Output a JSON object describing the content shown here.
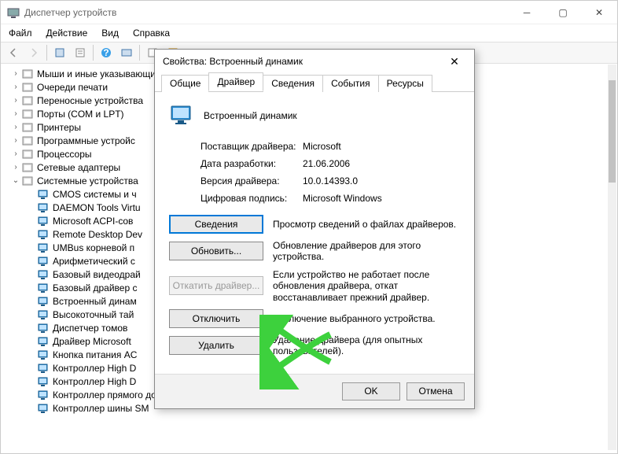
{
  "window": {
    "title": "Диспетчер устройств",
    "menu": {
      "file": "Файл",
      "action": "Действие",
      "view": "Вид",
      "help": "Справка"
    }
  },
  "tree": {
    "top": [
      {
        "label": "Мыши и иные указывающие",
        "icon": "mouse"
      },
      {
        "label": "Очереди печати",
        "icon": "printer"
      },
      {
        "label": "Переносные устройства",
        "icon": "portable"
      },
      {
        "label": "Порты (COM и LPT)",
        "icon": "port"
      },
      {
        "label": "Принтеры",
        "icon": "printer"
      },
      {
        "label": "Программные устройс",
        "icon": "soft"
      },
      {
        "label": "Процессоры",
        "icon": "cpu"
      },
      {
        "label": "Сетевые адаптеры",
        "icon": "net"
      }
    ],
    "sysnode": {
      "label": "Системные устройства",
      "icon": "sys"
    },
    "syschildren": [
      "CMOS системы и ч",
      "DAEMON Tools Virtu",
      "Microsoft ACPI-cов",
      "Remote Desktop Dev",
      "UMBus корневой п",
      "Арифметический с",
      "Базовый видеодрай",
      "Базовый драйвер с",
      "Встроенный динам",
      "Высокоточный тай",
      "Диспетчер томов",
      "Драйвер Microsoft",
      "Кнопка питания AC",
      "Контроллер High D",
      "Контроллер High D",
      "Контроллер прямого доступа к памяти",
      "Контроллер шины SM"
    ]
  },
  "dialog": {
    "title": "Свойства: Встроенный динамик",
    "tabs": {
      "general": "Общие",
      "driver": "Драйвер",
      "details": "Сведения",
      "events": "События",
      "resources": "Ресурсы"
    },
    "device_name": "Встроенный динамик",
    "info": {
      "provider_label": "Поставщик драйвера:",
      "provider_value": "Microsoft",
      "date_label": "Дата разработки:",
      "date_value": "21.06.2006",
      "version_label": "Версия драйвера:",
      "version_value": "10.0.14393.0",
      "sig_label": "Цифровая подпись:",
      "sig_value": "Microsoft Windows"
    },
    "buttons": {
      "details": "Сведения",
      "details_desc": "Просмотр сведений о файлах драйверов.",
      "update": "Обновить...",
      "update_desc": "Обновление драйверов для этого устройства.",
      "rollback": "Откатить драйвер...",
      "rollback_desc": "Если устройство не работает после обновления драйвера, откат восстанавливает прежний драйвер.",
      "disable": "Отключить",
      "disable_desc": "Отключение выбранного устройства.",
      "remove": "Удалить",
      "remove_desc": "Удаление драйвера (для опытных пользователей)."
    },
    "footer": {
      "ok": "OK",
      "cancel": "Отмена"
    }
  }
}
